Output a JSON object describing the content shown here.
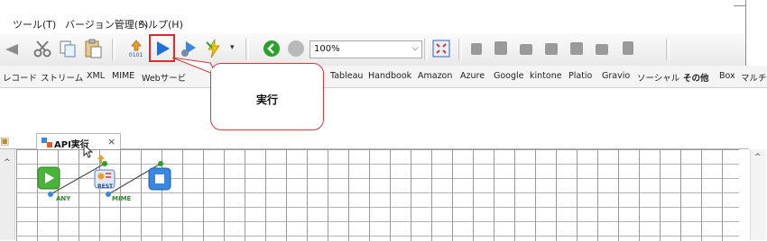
{
  "menu": {
    "items": [
      "ツール(T)",
      "バージョン管理(S)",
      "ヘルプ(H)"
    ]
  },
  "toolbar": {
    "zoom_value": "100%",
    "icons": [
      "ghost-arrow-icon",
      "cut-icon",
      "copy-icon",
      "paste-icon",
      "debug-step-icon",
      "run-icon",
      "run-debug-icon",
      "trigger-icon",
      "dropdown-icon",
      "go-icon",
      "stop-icon",
      "fit-icon",
      "align-icons"
    ]
  },
  "category_tabs": [
    "レコード",
    "ストリーム",
    "XML",
    "MIME",
    "Webサービ",
    "Tableau",
    "Handbook",
    "Amazon",
    "Azure",
    "Google",
    "kintone",
    "Platio",
    "Gravio",
    "ソーシャル",
    "その他",
    "Box",
    "マルチ"
  ],
  "selected_category": "その他",
  "callout": {
    "text": "実行"
  },
  "document_tab": {
    "label": "API実行",
    "close": "×"
  },
  "flow": {
    "nodes": [
      {
        "name": "start-node",
        "label": "ANY"
      },
      {
        "name": "rest-node",
        "label": "MIME",
        "badge": "REST"
      },
      {
        "name": "end-node",
        "label": ""
      }
    ]
  },
  "colors": {
    "accent_red": "#e02a2a",
    "run_blue": "#1e6fd6",
    "go_green": "#2aa12a"
  }
}
